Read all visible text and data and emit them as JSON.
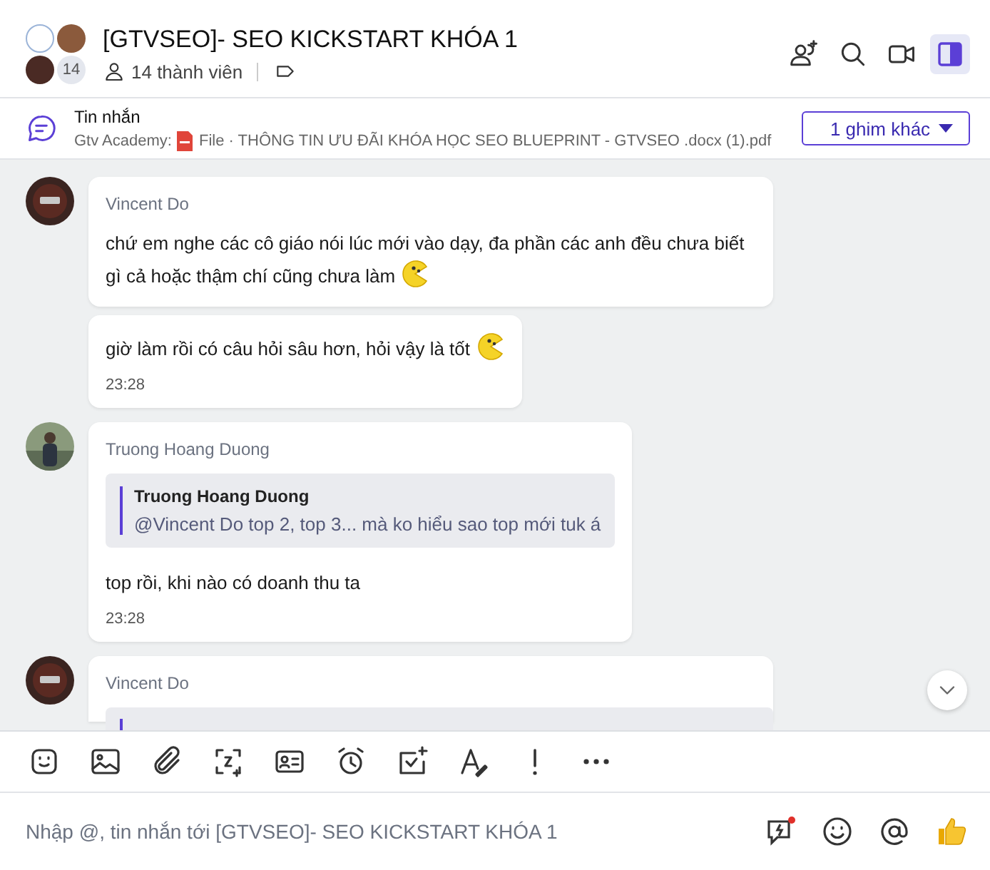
{
  "header": {
    "title": "[GTVSEO]- SEO KICKSTART KHÓA 1",
    "member_badge": "14",
    "members": "14 thành viên",
    "panel_open": true
  },
  "pinned": {
    "label": "Tin nhắn",
    "source": "Gtv Academy:",
    "file": "File · THÔNG TIN ƯU ĐÃI KHÓA HỌC SEO BLUEPRINT - GTVSEO .docx (1).pdf",
    "more_button": "1 ghim khác"
  },
  "messages": [
    {
      "sender": "Vincent Do",
      "bubbles": [
        {
          "text": "chứ em nghe các cô giáo nói lúc mới vào dạy, đa phần các anh đều chưa biết gì cả hoặc thậm chí cũng chưa làm",
          "emoji": true
        },
        {
          "text": "giờ làm rồi có câu hỏi sâu hơn, hỏi vậy là tốt",
          "emoji": true,
          "time": "23:28"
        }
      ]
    },
    {
      "sender": "Truong Hoang Duong",
      "quote": {
        "author": "Truong Hoang Duong",
        "text": "@Vincent Do top 2, top 3... mà ko hiểu sao top mới tuk á"
      },
      "bubbles": [
        {
          "text": "top rồi, khi nào có doanh thu ta",
          "emoji": false,
          "time": "23:28"
        }
      ]
    },
    {
      "sender": "Vincent Do",
      "quote_cut": true
    }
  ],
  "composer": {
    "placeholder": "Nhập @, tin nhắn tới [GTVSEO]- SEO KICKSTART KHÓA 1"
  }
}
